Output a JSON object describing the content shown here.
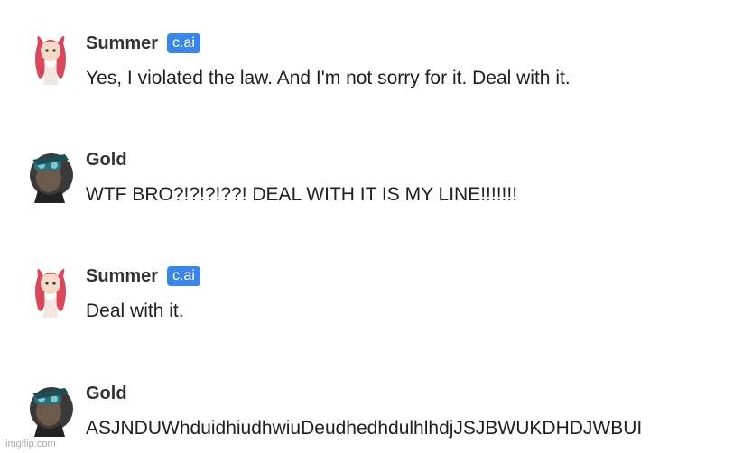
{
  "messages": [
    {
      "author": "Summer",
      "badge": "c.ai",
      "avatar_icon": "summer-avatar-icon",
      "text": "Yes, I violated the law. And I'm not sorry for it. Deal with it."
    },
    {
      "author": "Gold",
      "avatar_icon": "gold-avatar-icon",
      "text": "WTF BRO?!?!?!??! DEAL WITH IT IS MY LINE!!!!!!!"
    },
    {
      "author": "Summer",
      "badge": "c.ai",
      "avatar_icon": "summer-avatar-icon",
      "text": "Deal with it."
    },
    {
      "author": "Gold",
      "avatar_icon": "gold-avatar-icon",
      "text": "ASJNDUWhduidhiudhwiuDeudhedhdulhlhdjJSJBWUKDHDJWBUI"
    }
  ],
  "watermark": "imgflip.com",
  "colors": {
    "badge_bg": "#3a86e8",
    "summer_hair": "#d9475a",
    "gold_tint": "#2a6f7a"
  }
}
